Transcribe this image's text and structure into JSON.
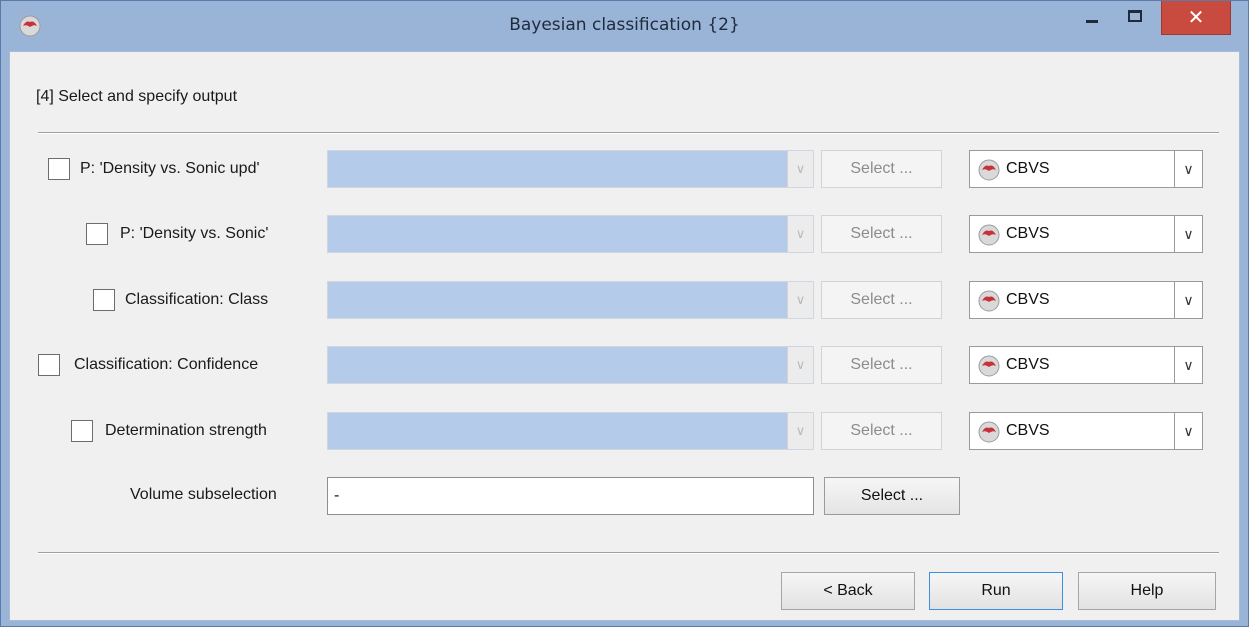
{
  "window": {
    "title": "Bayesian classification {2}",
    "close_label": "✕"
  },
  "step_label": "[4] Select and specify output",
  "outputs": [
    {
      "label": "P: 'Density vs. Sonic upd'",
      "checked": false,
      "select_label": "Select ...",
      "survey": "CBVS"
    },
    {
      "label": "P: 'Density vs. Sonic'",
      "checked": false,
      "select_label": "Select ...",
      "survey": "CBVS"
    },
    {
      "label": "Classification: Class",
      "checked": false,
      "select_label": "Select ...",
      "survey": "CBVS"
    },
    {
      "label": "Classification: Confidence",
      "checked": false,
      "select_label": "Select ...",
      "survey": "CBVS"
    },
    {
      "label": "Determination strength",
      "checked": false,
      "select_label": "Select ...",
      "survey": "CBVS"
    }
  ],
  "volume": {
    "label": "Volume subselection",
    "value": "-",
    "select_label": "Select ..."
  },
  "buttons": {
    "back": "< Back",
    "run": "Run",
    "help": "Help"
  },
  "colors": {
    "titlebar": "#9ab4d8",
    "close": "#c94b3f",
    "combo_disabled": "#b4cce9",
    "run_focus": "#3c8fdc"
  }
}
